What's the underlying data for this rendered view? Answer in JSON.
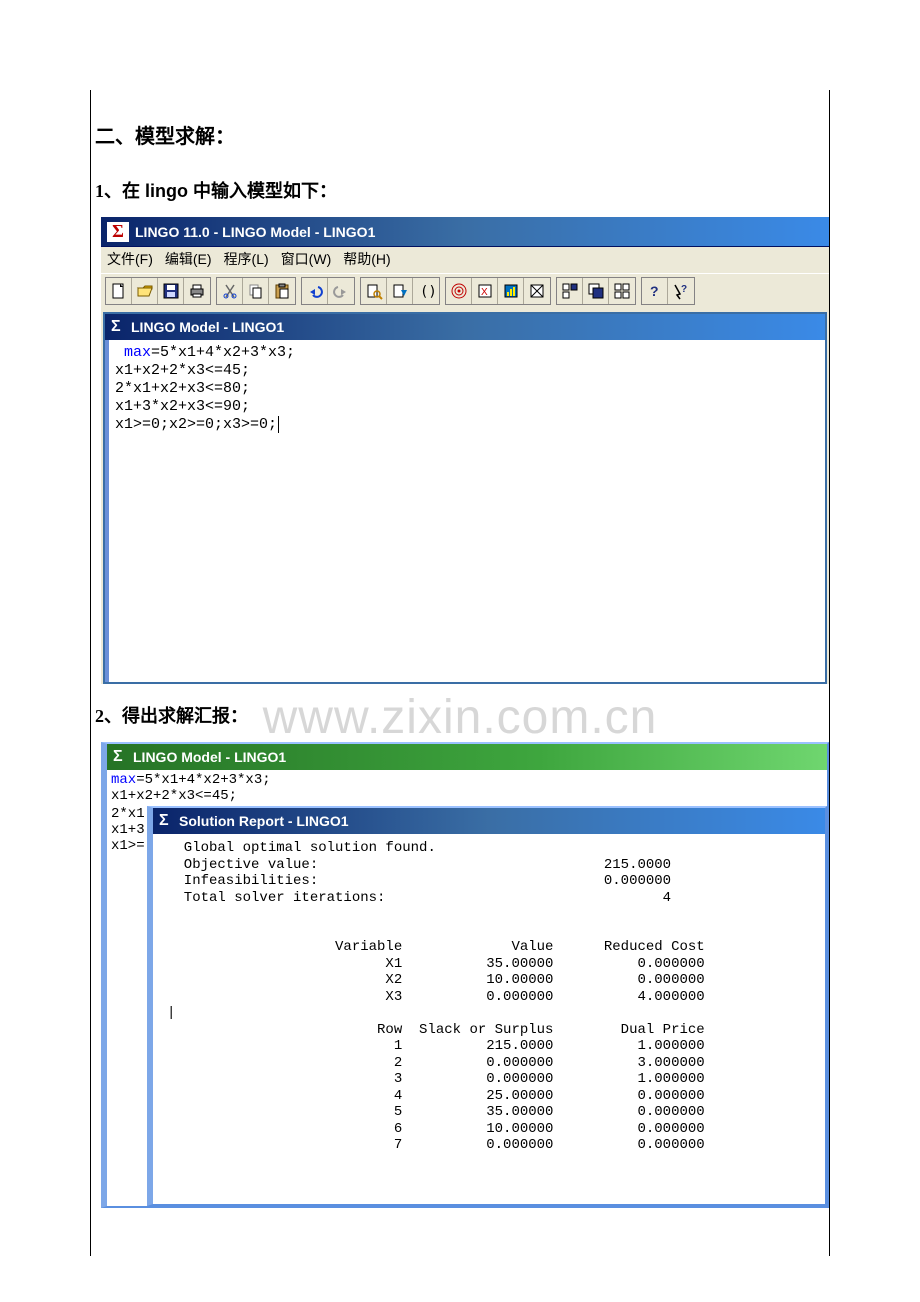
{
  "heading_section": "二、模型求解：",
  "sub1_num": "1",
  "sub1_body": "、在 lingo 中输入模型如下：",
  "sub2_num": "2",
  "sub2_body": "、得出求解汇报：",
  "watermark": "www.zixin.com.cn",
  "app": {
    "outer_title": "LINGO 11.0 - LINGO Model - LINGO1",
    "inner_title": "LINGO Model - LINGO1",
    "model_title": "LINGO Model - LINGO1",
    "solution_title": "Solution Report - LINGO1",
    "menu": {
      "file": "文件(F)",
      "edit": "编辑(E)",
      "lingo": "程序(L)",
      "window": "窗口(W)",
      "help": "帮助(H)"
    }
  },
  "code": {
    "l1a": "max",
    "l1b": "=5*x1+4*x2+3*x3;",
    "l2": "x1+x2+2*x3<=45;",
    "l3": "2*x1+x2+x3<=80;",
    "l4": "x1+3*x2+x3<=90;",
    "l5": "x1>=0;x2>=0;x3>=0;"
  },
  "stub": {
    "s1": "2*x1",
    "s2": "x1+3",
    "s3": "x1>="
  },
  "report": {
    "found": "  Global optimal solution found.",
    "obj_label": "  Objective value:",
    "obj_val": "215.0000",
    "inf_label": "  Infeasibilities:",
    "inf_val": "0.000000",
    "it_label": "  Total solver iterations:",
    "it_val": "4",
    "hdr_var": "Variable",
    "hdr_val": "Value",
    "hdr_rc": "Reduced Cost",
    "vars": [
      {
        "name": "X1",
        "value": "35.00000",
        "rc": "0.000000"
      },
      {
        "name": "X2",
        "value": "10.00000",
        "rc": "0.000000"
      },
      {
        "name": "X3",
        "value": "0.000000",
        "rc": "4.000000"
      }
    ],
    "hdr_row": "Row",
    "hdr_slack": "Slack or Surplus",
    "hdr_dual": "Dual Price",
    "rows": [
      {
        "r": "1",
        "slack": "215.0000",
        "dual": "1.000000"
      },
      {
        "r": "2",
        "slack": "0.000000",
        "dual": "3.000000"
      },
      {
        "r": "3",
        "slack": "0.000000",
        "dual": "1.000000"
      },
      {
        "r": "4",
        "slack": "25.00000",
        "dual": "0.000000"
      },
      {
        "r": "5",
        "slack": "35.00000",
        "dual": "0.000000"
      },
      {
        "r": "6",
        "slack": "10.00000",
        "dual": "0.000000"
      },
      {
        "r": "7",
        "slack": "0.000000",
        "dual": "0.000000"
      }
    ]
  }
}
